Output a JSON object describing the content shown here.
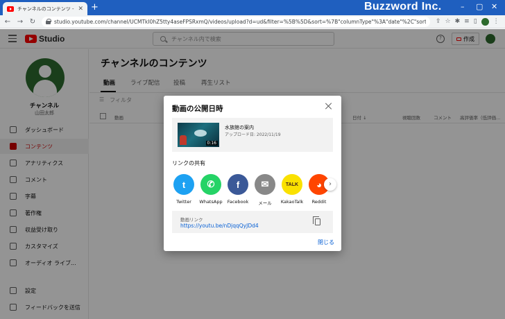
{
  "browser": {
    "tab_title": "チャンネルのコンテンツ - YouTube Studio",
    "new_tab": "+",
    "url": "studio.youtube.com/channel/UCMTkI0hZ5tty4aseFPSRxmQ/videos/upload?d=ud&filter=%5B%5D&sort=%7B\"columnType\"%3A\"date\"%2C\"sortOrder\"%3A\"DESCENDING\"%..."
  },
  "brand": "Buzzword Inc.",
  "studio": {
    "logo_text": "Studio",
    "search_placeholder": "チャンネル内で検索",
    "help": "?",
    "create_label": "作成"
  },
  "sidebar": {
    "channel_title": "チャンネル",
    "channel_user": "山田太郎",
    "items": [
      {
        "label": "ダッシュボード"
      },
      {
        "label": "コンテンツ"
      },
      {
        "label": "アナリティクス"
      },
      {
        "label": "コメント"
      },
      {
        "label": "字幕"
      },
      {
        "label": "著作権"
      },
      {
        "label": "収益受け取り"
      },
      {
        "label": "カスタマイズ"
      },
      {
        "label": "オーディオ ライブ..."
      },
      {
        "label": "設定"
      },
      {
        "label": "フィードバックを送信"
      }
    ]
  },
  "main": {
    "title": "チャンネルのコンテンツ",
    "tabs": [
      {
        "label": "動画"
      },
      {
        "label": "ライブ配信"
      },
      {
        "label": "投稿"
      },
      {
        "label": "再生リスト"
      }
    ],
    "filter_label": "フィルタ",
    "columns": {
      "video": "動画",
      "date": "日付 ↓",
      "views": "視聴回数",
      "comments": "コメント",
      "likes": "高評価率（低評価..."
    }
  },
  "dialog": {
    "title": "動画の公開日時",
    "video": {
      "title": "水族館の案内",
      "upload_date": "アップロード日: 2022/11/19",
      "duration": "0:16"
    },
    "share_label": "リンクの共有",
    "share_targets": [
      {
        "name": "Twitter",
        "glyph": "t",
        "color": "#1da1f2"
      },
      {
        "name": "WhatsApp",
        "glyph": "✆",
        "color": "#25d366"
      },
      {
        "name": "Facebook",
        "glyph": "f",
        "color": "#3b5998"
      },
      {
        "name": "メール",
        "glyph": "✉",
        "color": "#888888"
      },
      {
        "name": "KakaoTalk",
        "glyph": "TALK",
        "color": "#fae100"
      },
      {
        "name": "Reddit",
        "glyph": "◕",
        "color": "#ff4500"
      }
    ],
    "next_arrow": "›",
    "link_label": "動画リンク",
    "link_url": "https://youtu.be/nDjqqQyJDd4",
    "close_label": "閉じる"
  }
}
